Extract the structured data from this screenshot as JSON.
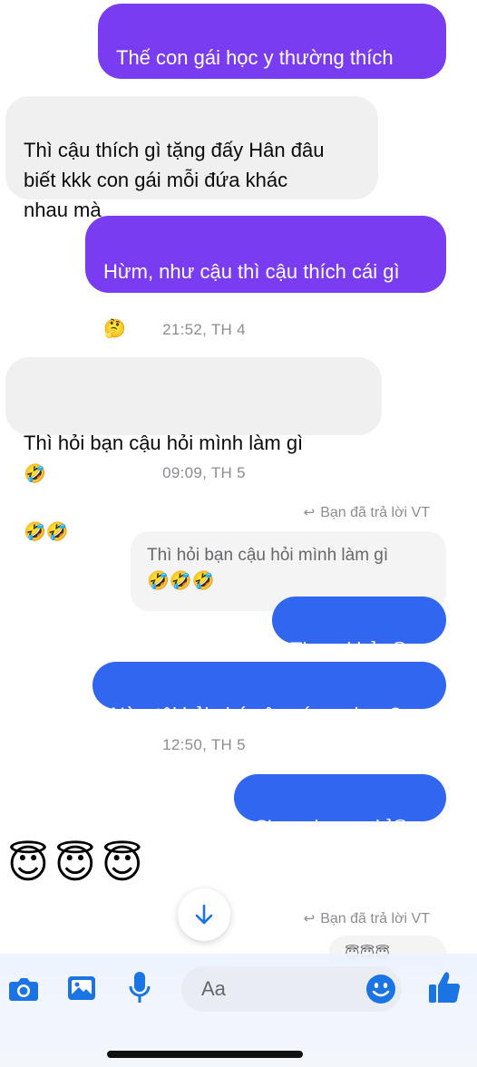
{
  "messages": {
    "m1": "Thế con gái học y thường thích\ngì cậu",
    "m2": "Thì cậu thích gì tặng đấy Hân đâu\nbiết kkk con gái mỗi đứa khác\nnhau mà",
    "m3": "Hừm, như cậu thì cậu thích cái gì",
    "m3_emoji": "🤔",
    "ts1": "21:52, TH 4",
    "m4": "Thì hỏi bạn cậu hỏi mình làm gì",
    "m4_emoji1": "🤣",
    "m4_emoji2": "🤣🤣",
    "ts2": "09:09, TH 5",
    "reply_note": "Bạn đã trả lời VT",
    "quoted_text": "Thì hỏi bạn cậu hỏi mình làm gì",
    "quoted_emoji": "🤣🤣🤣",
    "m5": "Tham khảo",
    "m5_emoji": "😆",
    "m6": "Này, tôi hỏi nhé cậu có ny chưa?",
    "ts3": "12:50, TH 5",
    "m7": "Ơ sao k rep nhỉ",
    "m7_emoji": "🙃",
    "incoming_emojis": "😇😇😇",
    "reply_note2": "Bạn đã trả lời VT",
    "partial_emojis": "😇😇😇"
  },
  "composer": {
    "placeholder": "Aa",
    "icons": [
      "camera-icon",
      "gallery-icon",
      "microphone-icon",
      "emoji-icon",
      "thumbs-up-icon"
    ]
  },
  "colors": {
    "purple_bubble": "#7a3cf1",
    "blue_bubble": "#3166f0",
    "incoming_bubble": "#f0f0f0",
    "accent_icon": "#1b74e4"
  }
}
